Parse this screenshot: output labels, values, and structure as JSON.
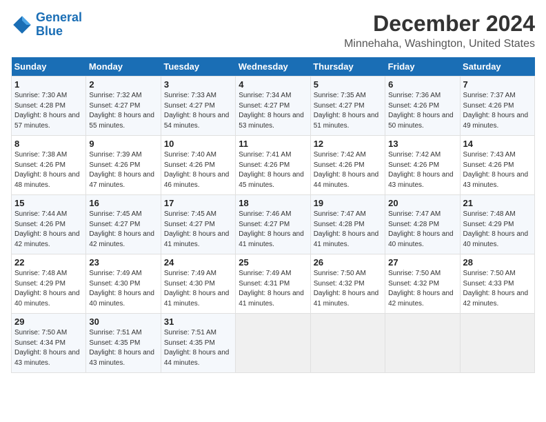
{
  "header": {
    "logo_line1": "General",
    "logo_line2": "Blue",
    "title": "December 2024",
    "subtitle": "Minnehaha, Washington, United States"
  },
  "days_of_week": [
    "Sunday",
    "Monday",
    "Tuesday",
    "Wednesday",
    "Thursday",
    "Friday",
    "Saturday"
  ],
  "weeks": [
    [
      {
        "day": "1",
        "sunrise": "7:30 AM",
        "sunset": "4:28 PM",
        "daylight": "8 hours and 57 minutes."
      },
      {
        "day": "2",
        "sunrise": "7:32 AM",
        "sunset": "4:27 PM",
        "daylight": "8 hours and 55 minutes."
      },
      {
        "day": "3",
        "sunrise": "7:33 AM",
        "sunset": "4:27 PM",
        "daylight": "8 hours and 54 minutes."
      },
      {
        "day": "4",
        "sunrise": "7:34 AM",
        "sunset": "4:27 PM",
        "daylight": "8 hours and 53 minutes."
      },
      {
        "day": "5",
        "sunrise": "7:35 AM",
        "sunset": "4:27 PM",
        "daylight": "8 hours and 51 minutes."
      },
      {
        "day": "6",
        "sunrise": "7:36 AM",
        "sunset": "4:26 PM",
        "daylight": "8 hours and 50 minutes."
      },
      {
        "day": "7",
        "sunrise": "7:37 AM",
        "sunset": "4:26 PM",
        "daylight": "8 hours and 49 minutes."
      }
    ],
    [
      {
        "day": "8",
        "sunrise": "7:38 AM",
        "sunset": "4:26 PM",
        "daylight": "8 hours and 48 minutes."
      },
      {
        "day": "9",
        "sunrise": "7:39 AM",
        "sunset": "4:26 PM",
        "daylight": "8 hours and 47 minutes."
      },
      {
        "day": "10",
        "sunrise": "7:40 AM",
        "sunset": "4:26 PM",
        "daylight": "8 hours and 46 minutes."
      },
      {
        "day": "11",
        "sunrise": "7:41 AM",
        "sunset": "4:26 PM",
        "daylight": "8 hours and 45 minutes."
      },
      {
        "day": "12",
        "sunrise": "7:42 AM",
        "sunset": "4:26 PM",
        "daylight": "8 hours and 44 minutes."
      },
      {
        "day": "13",
        "sunrise": "7:42 AM",
        "sunset": "4:26 PM",
        "daylight": "8 hours and 43 minutes."
      },
      {
        "day": "14",
        "sunrise": "7:43 AM",
        "sunset": "4:26 PM",
        "daylight": "8 hours and 43 minutes."
      }
    ],
    [
      {
        "day": "15",
        "sunrise": "7:44 AM",
        "sunset": "4:26 PM",
        "daylight": "8 hours and 42 minutes."
      },
      {
        "day": "16",
        "sunrise": "7:45 AM",
        "sunset": "4:27 PM",
        "daylight": "8 hours and 42 minutes."
      },
      {
        "day": "17",
        "sunrise": "7:45 AM",
        "sunset": "4:27 PM",
        "daylight": "8 hours and 41 minutes."
      },
      {
        "day": "18",
        "sunrise": "7:46 AM",
        "sunset": "4:27 PM",
        "daylight": "8 hours and 41 minutes."
      },
      {
        "day": "19",
        "sunrise": "7:47 AM",
        "sunset": "4:28 PM",
        "daylight": "8 hours and 41 minutes."
      },
      {
        "day": "20",
        "sunrise": "7:47 AM",
        "sunset": "4:28 PM",
        "daylight": "8 hours and 40 minutes."
      },
      {
        "day": "21",
        "sunrise": "7:48 AM",
        "sunset": "4:29 PM",
        "daylight": "8 hours and 40 minutes."
      }
    ],
    [
      {
        "day": "22",
        "sunrise": "7:48 AM",
        "sunset": "4:29 PM",
        "daylight": "8 hours and 40 minutes."
      },
      {
        "day": "23",
        "sunrise": "7:49 AM",
        "sunset": "4:30 PM",
        "daylight": "8 hours and 40 minutes."
      },
      {
        "day": "24",
        "sunrise": "7:49 AM",
        "sunset": "4:30 PM",
        "daylight": "8 hours and 41 minutes."
      },
      {
        "day": "25",
        "sunrise": "7:49 AM",
        "sunset": "4:31 PM",
        "daylight": "8 hours and 41 minutes."
      },
      {
        "day": "26",
        "sunrise": "7:50 AM",
        "sunset": "4:32 PM",
        "daylight": "8 hours and 41 minutes."
      },
      {
        "day": "27",
        "sunrise": "7:50 AM",
        "sunset": "4:32 PM",
        "daylight": "8 hours and 42 minutes."
      },
      {
        "day": "28",
        "sunrise": "7:50 AM",
        "sunset": "4:33 PM",
        "daylight": "8 hours and 42 minutes."
      }
    ],
    [
      {
        "day": "29",
        "sunrise": "7:50 AM",
        "sunset": "4:34 PM",
        "daylight": "8 hours and 43 minutes."
      },
      {
        "day": "30",
        "sunrise": "7:51 AM",
        "sunset": "4:35 PM",
        "daylight": "8 hours and 43 minutes."
      },
      {
        "day": "31",
        "sunrise": "7:51 AM",
        "sunset": "4:35 PM",
        "daylight": "8 hours and 44 minutes."
      },
      null,
      null,
      null,
      null
    ]
  ],
  "labels": {
    "sunrise": "Sunrise:",
    "sunset": "Sunset:",
    "daylight": "Daylight:"
  },
  "colors": {
    "header_bg": "#1a6eb5",
    "row_odd_bg": "#f5f8fc",
    "row_even_bg": "#ffffff",
    "empty_bg": "#f0f0f0"
  }
}
